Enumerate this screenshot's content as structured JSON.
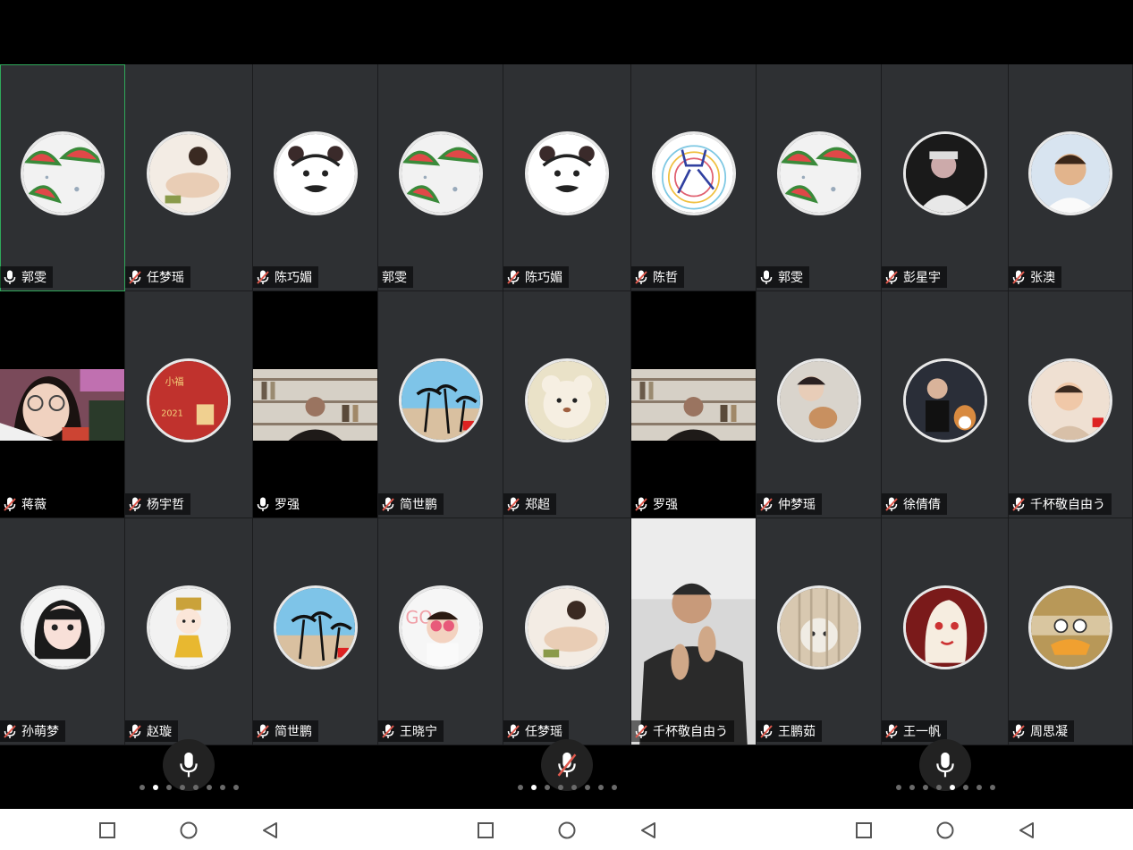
{
  "colors": {
    "tile": "#2e3033",
    "active_border": "#2fa85a",
    "muted_mic": "#e05a4e",
    "nav_icon": "#555555"
  },
  "tiles": [
    {
      "name": "郭雯",
      "mic": "on",
      "avatar": "watermelon",
      "active": true
    },
    {
      "name": "任梦瑶",
      "mic": "muted",
      "avatar": "portrait-lying"
    },
    {
      "name": "陈巧媚",
      "mic": "muted",
      "avatar": "cartoon-face"
    },
    {
      "name": "郭雯",
      "mic": "none",
      "avatar": "watermelon"
    },
    {
      "name": "陈巧媚",
      "mic": "muted",
      "avatar": "cartoon-face"
    },
    {
      "name": "陈哲",
      "mic": "muted",
      "avatar": "rainbow-sketch"
    },
    {
      "name": "郭雯",
      "mic": "on",
      "avatar": "watermelon"
    },
    {
      "name": "彭星宇",
      "mic": "muted",
      "avatar": "man-dark"
    },
    {
      "name": "张澳",
      "mic": "muted",
      "avatar": "boy-photo"
    },
    {
      "name": "蒋薇",
      "mic": "muted",
      "video": "girl-glasses"
    },
    {
      "name": "杨宇哲",
      "mic": "muted",
      "avatar": "red-greeting-card"
    },
    {
      "name": "罗强",
      "mic": "on",
      "video": "man-bookshelf"
    },
    {
      "name": "简世鹏",
      "mic": "muted",
      "avatar": "palm-trees"
    },
    {
      "name": "郑超",
      "mic": "muted",
      "avatar": "teddy-bear"
    },
    {
      "name": "罗强",
      "mic": "muted",
      "video": "man-bookshelf"
    },
    {
      "name": "仲梦瑶",
      "mic": "muted",
      "avatar": "woman-cat"
    },
    {
      "name": "徐倩倩",
      "mic": "muted",
      "avatar": "man-dog"
    },
    {
      "name": "千杯敬自由う",
      "mic": "muted",
      "avatar": "baby-photo"
    },
    {
      "name": "孙萌梦",
      "mic": "muted",
      "avatar": "anime-girl"
    },
    {
      "name": "赵璇",
      "mic": "muted",
      "avatar": "cartoon-princess"
    },
    {
      "name": "简世鹏",
      "mic": "muted",
      "avatar": "palm-trees"
    },
    {
      "name": "王晓宁",
      "mic": "muted",
      "avatar": "baby-sunglasses"
    },
    {
      "name": "任梦瑶",
      "mic": "muted",
      "avatar": "portrait-lying"
    },
    {
      "name": "千杯敬自由う",
      "mic": "muted",
      "video": "man-clapping"
    },
    {
      "name": "王鹏茹",
      "mic": "muted",
      "avatar": "cat-cage"
    },
    {
      "name": "王一帆",
      "mic": "muted",
      "avatar": "cartoon-woman-red"
    },
    {
      "name": "周思凝",
      "mic": "muted",
      "avatar": "cartoon-crab"
    }
  ],
  "bottom_bar": {
    "panels": [
      {
        "mic_button": "mic-on-icon",
        "dots": 8,
        "active_dot": 2
      },
      {
        "mic_button": "mic-off-icon",
        "dots": 8,
        "active_dot": 2
      },
      {
        "mic_button": "mic-on-icon",
        "dots": 8,
        "active_dot": 5
      }
    ]
  },
  "nav_buttons": [
    "recent-apps-icon",
    "home-icon",
    "back-icon"
  ]
}
